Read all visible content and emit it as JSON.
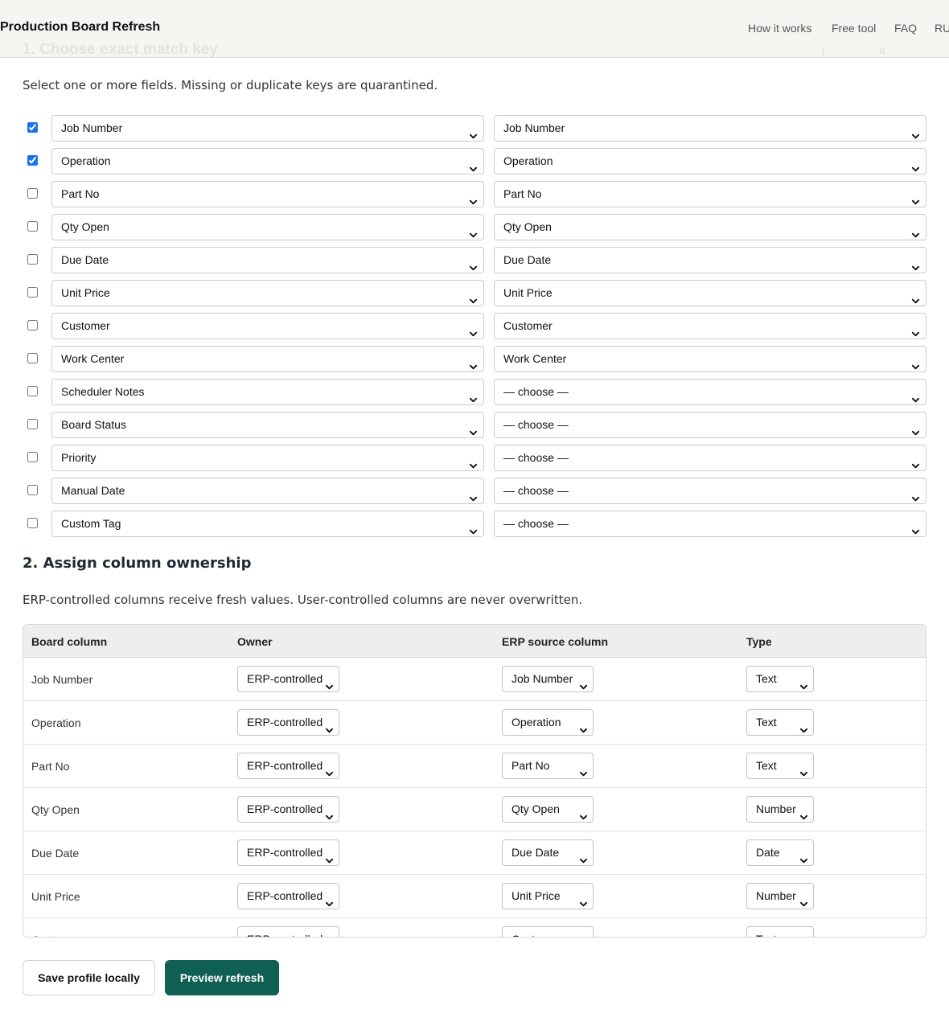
{
  "header": {
    "brand": "Production Board Refresh",
    "nav": [
      {
        "label": "How it works"
      },
      {
        "label": "Free tool"
      },
      {
        "label": "FAQ"
      },
      {
        "label": "RU"
      }
    ]
  },
  "section1": {
    "title": "1. Choose exact match key",
    "description": "Select one or more fields. Missing or duplicate keys are quarantined.",
    "rows": [
      {
        "checked": true,
        "left": "Job Number",
        "right": "Job Number"
      },
      {
        "checked": true,
        "left": "Operation",
        "right": "Operation"
      },
      {
        "checked": false,
        "left": "Part No",
        "right": "Part No"
      },
      {
        "checked": false,
        "left": "Qty Open",
        "right": "Qty Open"
      },
      {
        "checked": false,
        "left": "Due Date",
        "right": "Due Date"
      },
      {
        "checked": false,
        "left": "Unit Price",
        "right": "Unit Price"
      },
      {
        "checked": false,
        "left": "Customer",
        "right": "Customer"
      },
      {
        "checked": false,
        "left": "Work Center",
        "right": "Work Center"
      },
      {
        "checked": false,
        "left": "Scheduler Notes",
        "right": "— choose —"
      },
      {
        "checked": false,
        "left": "Board Status",
        "right": "— choose —"
      },
      {
        "checked": false,
        "left": "Priority",
        "right": "— choose —"
      },
      {
        "checked": false,
        "left": "Manual Date",
        "right": "— choose —"
      },
      {
        "checked": false,
        "left": "Custom Tag",
        "right": "— choose —"
      }
    ]
  },
  "section2": {
    "title": "2. Assign column ownership",
    "description": "ERP-controlled columns receive fresh values. User-controlled columns are never overwritten.",
    "columns": [
      "Board column",
      "Owner",
      "ERP source column",
      "Type"
    ],
    "rows": [
      {
        "board": "Job Number",
        "owner": "ERP-controlled",
        "source": "Job Number",
        "type": "Text"
      },
      {
        "board": "Operation",
        "owner": "ERP-controlled",
        "source": "Operation",
        "type": "Text"
      },
      {
        "board": "Part No",
        "owner": "ERP-controlled",
        "source": "Part No",
        "type": "Text"
      },
      {
        "board": "Qty Open",
        "owner": "ERP-controlled",
        "source": "Qty Open",
        "type": "Number"
      },
      {
        "board": "Due Date",
        "owner": "ERP-controlled",
        "source": "Due Date",
        "type": "Date"
      },
      {
        "board": "Unit Price",
        "owner": "ERP-controlled",
        "source": "Unit Price",
        "type": "Number"
      },
      {
        "board": "Customer",
        "owner": "ERP-controlled",
        "source": "Customer",
        "type": "Text"
      }
    ]
  },
  "actions": {
    "save": "Save profile locally",
    "preview": "Preview refresh"
  },
  "colors": {
    "accent": "#0f5f53",
    "checkbox": "#1a73e8",
    "header_bg": "#f5f5f1"
  }
}
